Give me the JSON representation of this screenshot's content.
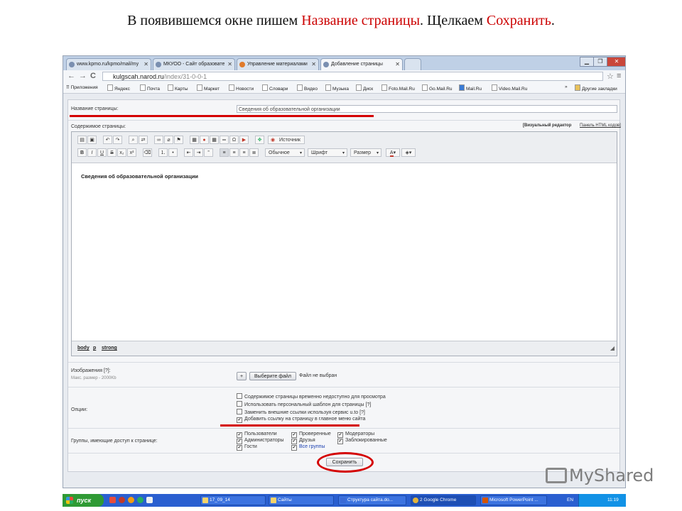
{
  "caption": {
    "part1": "В появившемся окне пишем ",
    "part2": "Название страницы",
    "part3": ". Щелкаем ",
    "part4": "Сохранить",
    "part5": "."
  },
  "browser": {
    "tabs": [
      {
        "label": "www.kpmo.ru/kpmo/mail/my"
      },
      {
        "label": "МКУОО - Сайт образовате"
      },
      {
        "label": "Управление материалами"
      },
      {
        "label": "Добавление страницы"
      }
    ],
    "url_host": "kulgscah.narod.ru",
    "url_path": "/index/31-0-0-1",
    "bookmarks": [
      "Приложения",
      "Яндекс",
      "Почта",
      "Карты",
      "Маркет",
      "Новости",
      "Словари",
      "Видео",
      "Музыка",
      "Диск",
      "Foto.Mail.Ru",
      "Go.Mail.Ru",
      "Mail.Ru",
      "Video.Mail.Ru"
    ],
    "other_bookmarks": "Другие закладки",
    "more": "»"
  },
  "form": {
    "title_label": "Название страницы:",
    "title_value": "Сведения об образовательной организации",
    "content_label": "Содержимое страницы:",
    "visual_editor": "[Визуальный редактор",
    "html_panel": "Панель HTML кодов]",
    "source_button": "Источник",
    "format_select": "Обычное",
    "font_select": "Шрифт",
    "size_select": "Размер",
    "editor_text": "Сведения об образовательной организации",
    "path_body": "body",
    "path_p": "p",
    "path_strong": "strong",
    "images_label": "Изображения [?]:",
    "images_hint": "Макс. размер - 2000Kb",
    "add_button": "+",
    "choose_file": "Выберите файл",
    "no_file": "Файл не выбран",
    "options_label": "Опции:",
    "options": [
      {
        "label": "Содержимое страницы временно недоступно для просмотра",
        "checked": false
      },
      {
        "label": "Использовать персональный шаблон для страницы [?]",
        "checked": false
      },
      {
        "label": "Заменить внешние ссылки используя сервис u.to [?]",
        "checked": false
      },
      {
        "label": "Добавить ссылку на страницу в главное меню сайта",
        "checked": true
      }
    ],
    "groups_label": "Группы, имеющие доступ к странице:",
    "groups": {
      "col1": [
        "Пользователи",
        "Администраторы",
        "Гости"
      ],
      "col2": [
        "Проверенные",
        "Друзья",
        "Все группы"
      ],
      "col3": [
        "Модераторы",
        "Заблокированные"
      ]
    },
    "save_button": "Сохранить"
  },
  "taskbar": {
    "start": "пуск",
    "tasks": [
      "17_09_14",
      "Сайты",
      "Структура сайта.do...",
      "2 Google Chrome",
      "Microsoft PowerPoint ..."
    ],
    "lang": "EN",
    "time": "11:19"
  },
  "watermark": "MyShared",
  "colors": {
    "accent_red": "#d40000",
    "taskbar_blue": "#2a5fd0",
    "start_green": "#2f9a34"
  }
}
